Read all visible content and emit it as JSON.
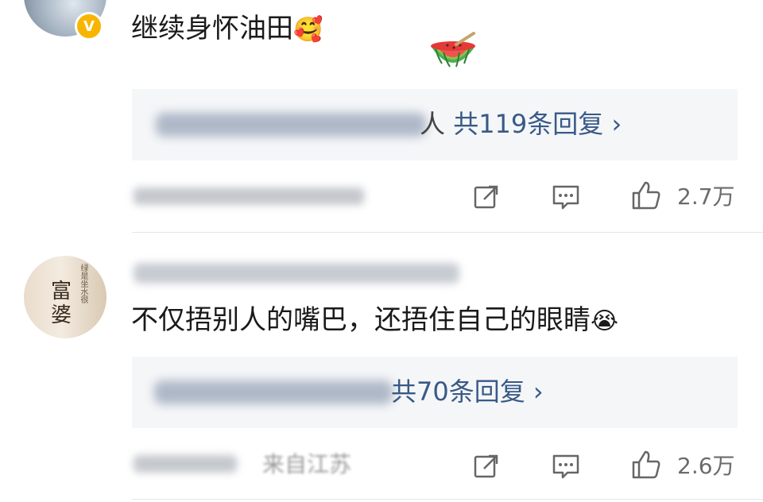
{
  "comments": [
    {
      "text": "继续身怀油田",
      "emoji": "🥰",
      "replies": {
        "prefix_visible": "人",
        "count_label": "共119条回复",
        "chevron": "›"
      },
      "like_count": "2.7万",
      "icons": {
        "share": "share-icon",
        "reply": "comment-icon",
        "like": "like-icon",
        "verified": "verified-badge-icon"
      }
    },
    {
      "text": "不仅捂别人的嘴巴，还捂住自己的眼睛",
      "emoji": "😭",
      "avatar_text": "富婆",
      "avatar_vertical_text": "绿是坐水很",
      "replies": {
        "count_label": "共70条回复",
        "chevron": "›"
      },
      "meta_visible": "来自江苏",
      "like_count": "2.6万",
      "icons": {
        "share": "share-icon",
        "reply": "comment-icon",
        "like": "like-icon"
      }
    }
  ],
  "colors": {
    "link": "#385a87",
    "reply_bg": "#f5f6f8",
    "badge": "#f7b500",
    "meta": "#9a9a9a"
  }
}
